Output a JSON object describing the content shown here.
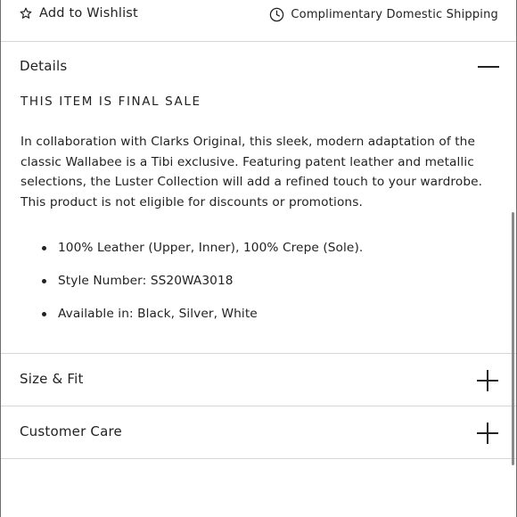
{
  "top_bar": {
    "wishlist_label": "Add to Wishlist",
    "wishlist_icon": "star-outline-icon",
    "shipping_label": "Complimentary Domestic Shipping",
    "shipping_icon": "clock-icon"
  },
  "details": {
    "title": "Details",
    "state": "expanded",
    "toggle_icon": "minus-icon",
    "final_sale": "THIS ITEM IS FINAL SALE",
    "description": "In collaboration with Clarks Original, this sleek, modern adaptation of the classic Wallabee is a Tibi exclusive. Featuring patent leather and metallic selections, the Luster Collection will add a refined touch to your wardrobe. This product is not eligible for discounts or promotions.",
    "bullets": [
      "100% Leather (Upper, Inner), 100% Crepe (Sole).",
      "Style Number: SS20WA3018",
      "Available in: Black, Silver, White"
    ]
  },
  "size_fit": {
    "title": "Size & Fit",
    "state": "collapsed",
    "toggle_icon": "plus-icon"
  },
  "customer_care": {
    "title": "Customer Care",
    "state": "collapsed",
    "toggle_icon": "plus-icon"
  },
  "colors": {
    "text": "#222222",
    "divider": "#d6d6d6",
    "background": "#ffffff"
  }
}
